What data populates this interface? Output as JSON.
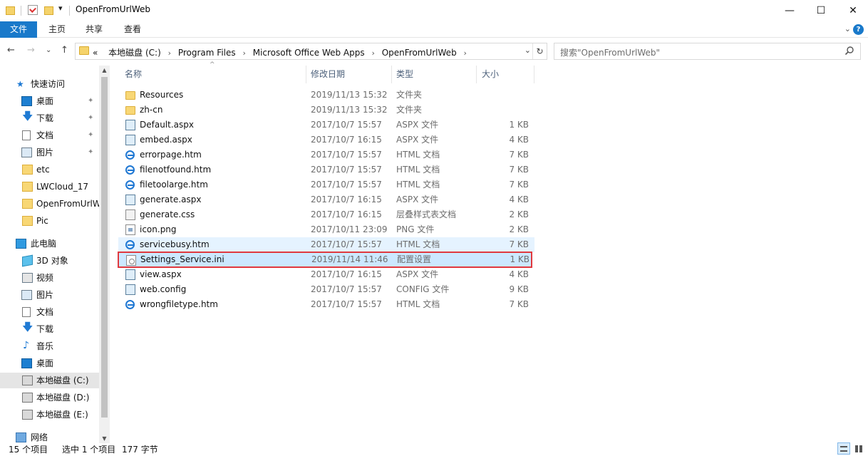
{
  "window": {
    "title": "OpenFromUrlWeb",
    "controls": {
      "minimize": "—",
      "maximize": "☐",
      "close": "✕"
    }
  },
  "quick_access_toolbar": {
    "dropdown": "▾"
  },
  "ribbon": {
    "tabs": [
      "文件",
      "主页",
      "共享",
      "查看"
    ],
    "expand": "⌄",
    "help": "?"
  },
  "nav": {
    "back": "←",
    "forward": "→",
    "recent": "⌄",
    "up": "↑",
    "address": {
      "overflow": "«",
      "crumbs": [
        "本地磁盘 (C:)",
        "Program Files",
        "Microsoft Office Web Apps",
        "OpenFromUrlWeb"
      ],
      "separator": "›",
      "dropdown": "⌄",
      "refresh": "↻"
    },
    "search": {
      "placeholder": "搜索\"OpenFromUrlWeb\"",
      "icon": "search-icon"
    }
  },
  "sidebar": {
    "quick_access": {
      "label": "快速访问",
      "items": [
        {
          "label": "桌面",
          "icon": "desktop-icon",
          "pinned": true
        },
        {
          "label": "下载",
          "icon": "download-icon",
          "pinned": true
        },
        {
          "label": "文档",
          "icon": "document-icon",
          "pinned": true
        },
        {
          "label": "图片",
          "icon": "picture-icon",
          "pinned": true
        },
        {
          "label": "etc",
          "icon": "folder-icon",
          "pinned": false
        },
        {
          "label": "LWCloud_17",
          "icon": "folder-icon",
          "pinned": false
        },
        {
          "label": "OpenFromUrlW",
          "icon": "folder-icon",
          "pinned": false
        },
        {
          "label": "Pic",
          "icon": "folder-icon",
          "pinned": false
        }
      ]
    },
    "this_pc": {
      "label": "此电脑",
      "items": [
        {
          "label": "3D 对象",
          "icon": "3d-objects-icon"
        },
        {
          "label": "视频",
          "icon": "video-icon"
        },
        {
          "label": "图片",
          "icon": "picture-icon"
        },
        {
          "label": "文档",
          "icon": "document-icon"
        },
        {
          "label": "下载",
          "icon": "download-icon"
        },
        {
          "label": "音乐",
          "icon": "music-icon"
        },
        {
          "label": "桌面",
          "icon": "desktop-icon"
        },
        {
          "label": "本地磁盘 (C:)",
          "icon": "drive-icon",
          "selected": true
        },
        {
          "label": "本地磁盘 (D:)",
          "icon": "drive-icon"
        },
        {
          "label": "本地磁盘 (E:)",
          "icon": "drive-icon"
        }
      ]
    },
    "network": {
      "label": "网络"
    },
    "pin_glyph": "📌"
  },
  "file_list": {
    "sort_indicator": "^",
    "columns": {
      "name": "名称",
      "date": "修改日期",
      "type": "类型",
      "size": "大小"
    },
    "rows": [
      {
        "name": "Resources",
        "date": "2019/11/13 15:32",
        "type": "文件夹",
        "size": "",
        "icon": "folder"
      },
      {
        "name": "zh-cn",
        "date": "2019/11/13 15:32",
        "type": "文件夹",
        "size": "",
        "icon": "folder"
      },
      {
        "name": "Default.aspx",
        "date": "2017/10/7 15:57",
        "type": "ASPX 文件",
        "size": "1 KB",
        "icon": "aspx"
      },
      {
        "name": "embed.aspx",
        "date": "2017/10/7 16:15",
        "type": "ASPX 文件",
        "size": "4 KB",
        "icon": "aspx"
      },
      {
        "name": "errorpage.htm",
        "date": "2017/10/7 15:57",
        "type": "HTML 文档",
        "size": "7 KB",
        "icon": "ie"
      },
      {
        "name": "filenotfound.htm",
        "date": "2017/10/7 15:57",
        "type": "HTML 文档",
        "size": "7 KB",
        "icon": "ie"
      },
      {
        "name": "filetoolarge.htm",
        "date": "2017/10/7 15:57",
        "type": "HTML 文档",
        "size": "7 KB",
        "icon": "ie"
      },
      {
        "name": "generate.aspx",
        "date": "2017/10/7 16:15",
        "type": "ASPX 文件",
        "size": "4 KB",
        "icon": "aspx"
      },
      {
        "name": "generate.css",
        "date": "2017/10/7 16:15",
        "type": "层叠样式表文档",
        "size": "2 KB",
        "icon": "css"
      },
      {
        "name": "icon.png",
        "date": "2017/10/11 23:09",
        "type": "PNG 文件",
        "size": "2 KB",
        "icon": "png"
      },
      {
        "name": "servicebusy.htm",
        "date": "2017/10/7 15:57",
        "type": "HTML 文档",
        "size": "7 KB",
        "icon": "ie",
        "state": "hover"
      },
      {
        "name": "Settings_Service.ini",
        "date": "2019/11/14 11:46",
        "type": "配置设置",
        "size": "1 KB",
        "icon": "ini",
        "state": "selected"
      },
      {
        "name": "view.aspx",
        "date": "2017/10/7 16:15",
        "type": "ASPX 文件",
        "size": "4 KB",
        "icon": "aspx"
      },
      {
        "name": "web.config",
        "date": "2017/10/7 15:57",
        "type": "CONFIG 文件",
        "size": "9 KB",
        "icon": "aspx"
      },
      {
        "name": "wrongfiletype.htm",
        "date": "2017/10/7 15:57",
        "type": "HTML 文档",
        "size": "7 KB",
        "icon": "ie"
      }
    ]
  },
  "status": {
    "count": "15 个项目",
    "selected": "选中 1 个项目",
    "size": "177 字节"
  },
  "colors": {
    "accent": "#1979ca",
    "selection_outline": "#e0393e",
    "selection_bg": "#cce8ff"
  }
}
